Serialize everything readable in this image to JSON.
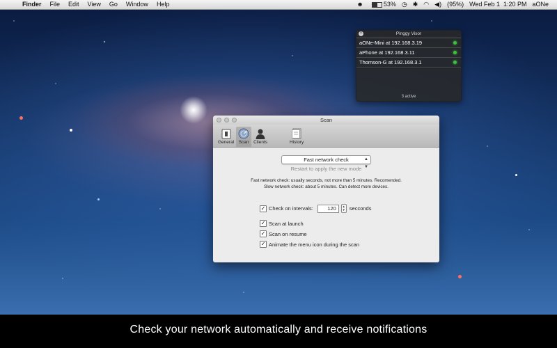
{
  "menubar": {
    "apple": "",
    "app_name": "Finder",
    "items": [
      "File",
      "Edit",
      "View",
      "Go",
      "Window",
      "Help"
    ],
    "battery_percent": "53%",
    "battery_level": 0.53,
    "volume_percent": "(95%)",
    "datetime": "Wed Feb 1  1:20 PM",
    "user": "aONe"
  },
  "visor": {
    "title": "Pinggy Visor",
    "hosts": [
      {
        "name": "aONe-Mini at 192.168.3.19",
        "status_color": "#3cc23c"
      },
      {
        "name": "aPhone at 192.168.3.11",
        "status_color": "#3cc23c"
      },
      {
        "name": "Thomson-G at 192.168.3.1",
        "status_color": "#3cc23c"
      }
    ],
    "footer": "3 active"
  },
  "scan_window": {
    "title": "Scan",
    "tabs": [
      {
        "label": "General",
        "icon": "general-icon"
      },
      {
        "label": "Scan",
        "icon": "scan-radar-icon"
      },
      {
        "label": "Clients",
        "icon": "clients-icon"
      },
      {
        "label": "History",
        "icon": "history-icon"
      }
    ],
    "selected_tab": "Scan",
    "mode_select": "Fast network check",
    "restart_note": "Restart to apply the new mode",
    "desc_fast": "Fast network check:  usually seconds, not more than 5 minutes. Recomended.",
    "desc_slow": "Slow network check: about 5 minutes. Can detect more devices.",
    "check_intervals_label": "Check on intervals:",
    "interval_value": "120",
    "interval_unit": "secconds",
    "scan_at_launch": "Scan at launch",
    "scan_on_resume": "Scan on resume",
    "animate_icon": "Animate the menu icon during the scan"
  },
  "caption": "Check your network automatically and receive notifications",
  "colors": {
    "status_online": "#3cc23c",
    "caption_bg": "#000000"
  }
}
